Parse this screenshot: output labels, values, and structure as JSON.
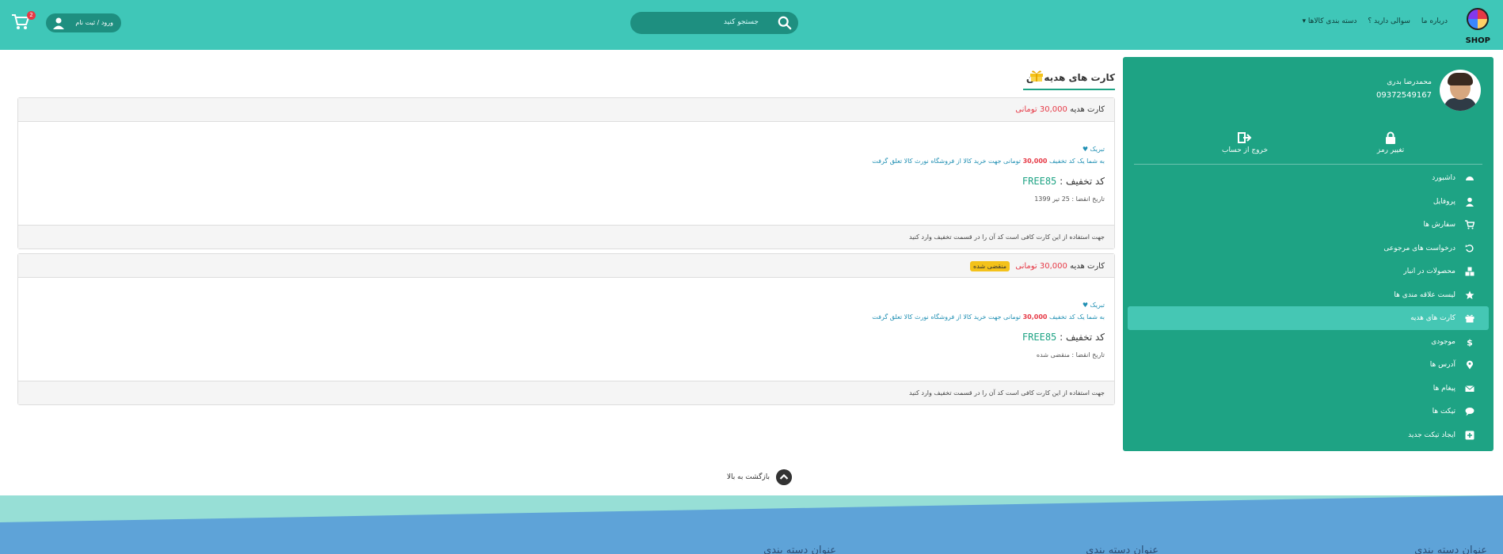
{
  "header": {
    "logo_text": "SHOP",
    "nav": [
      "دسته بندی کالاها ▾",
      "سوالی دارید ؟",
      "درباره ما"
    ],
    "search_placeholder": "جستجو کنید",
    "login_label": "ورود / ثبت نام",
    "cart_count": "2"
  },
  "sidebar": {
    "user_name": "محمدرضا بدری",
    "phone": "09372549167",
    "account_actions": [
      {
        "label": "تغییر رمز",
        "icon": "lock-icon"
      },
      {
        "label": "خروج از حساب",
        "icon": "sign-out-icon"
      }
    ],
    "menu": [
      {
        "label": "داشبورد",
        "icon": "dashboard-icon",
        "active": false
      },
      {
        "label": "پروفایل",
        "icon": "user-icon",
        "active": false
      },
      {
        "label": "سفارش ها",
        "icon": "cart-icon",
        "active": false
      },
      {
        "label": "درخواست های مرجوعی",
        "icon": "undo-icon",
        "active": false
      },
      {
        "label": "محصولات در انبار",
        "icon": "boxes-icon",
        "active": false
      },
      {
        "label": "لیست علاقه مندی ها",
        "icon": "star-icon",
        "active": false
      },
      {
        "label": "کارت های هدیه",
        "icon": "gift-icon",
        "active": true
      },
      {
        "label": "موجودی",
        "icon": "dollar-icon",
        "active": false
      },
      {
        "label": "آدرس ها",
        "icon": "map-pin-icon",
        "active": false
      },
      {
        "label": "پیغام ها",
        "icon": "envelope-icon",
        "active": false
      },
      {
        "label": "تیکت ها",
        "icon": "chat-icon",
        "active": false
      },
      {
        "label": "ایجاد تیکت جدید",
        "icon": "plus-square-icon",
        "active": false
      }
    ]
  },
  "main": {
    "title": "کارت های هدیه من",
    "cards": [
      {
        "title_prefix": "کارت هدیه",
        "amount": "30,000",
        "currency": "تومانی",
        "expired_badge": "",
        "congrats": "تبریک ♥",
        "desc_before": "به شما یک کد تخفیف",
        "desc_amount": "30,000",
        "desc_after": "تومانی جهت خرید کالا از فروشگاه نورث کالا تعلق گرفت",
        "code_label": "کد تخفیف :",
        "code": "FREE85",
        "date_label": "تاریخ انقضا :",
        "date": "25 تیر 1399",
        "footer": "جهت استفاده از این کارت کافی است کد آن را در قسمت تخفیف وارد کنید"
      },
      {
        "title_prefix": "کارت هدیه",
        "amount": "30,000",
        "currency": "تومانی",
        "expired_badge": "منقضی شده",
        "congrats": "تبریک ♥",
        "desc_before": "به شما یک کد تخفیف",
        "desc_amount": "30,000",
        "desc_after": "تومانی جهت خرید کالا از فروشگاه نورث کالا تعلق گرفت",
        "code_label": "کد تخفیف :",
        "code": "FREE85",
        "date_label": "تاریخ انقضا :",
        "date": "منقضی شده",
        "footer": "جهت استفاده از این کارت کافی است کد آن را در قسمت تخفیف وارد کنید"
      }
    ],
    "back_to_top": "بازگشت به بالا"
  },
  "footer": {
    "columns": [
      "عنوان دسته بندی",
      "عنوان دسته بندی",
      "عنوان دسته بندی"
    ]
  },
  "colors": {
    "header": "#3fc7b8",
    "sidebar": "#1ea384",
    "sidebar_active": "#45c7b4",
    "price": "#e63946",
    "badge": "#f4c21a",
    "footer_blue": "#5ea3d8"
  }
}
